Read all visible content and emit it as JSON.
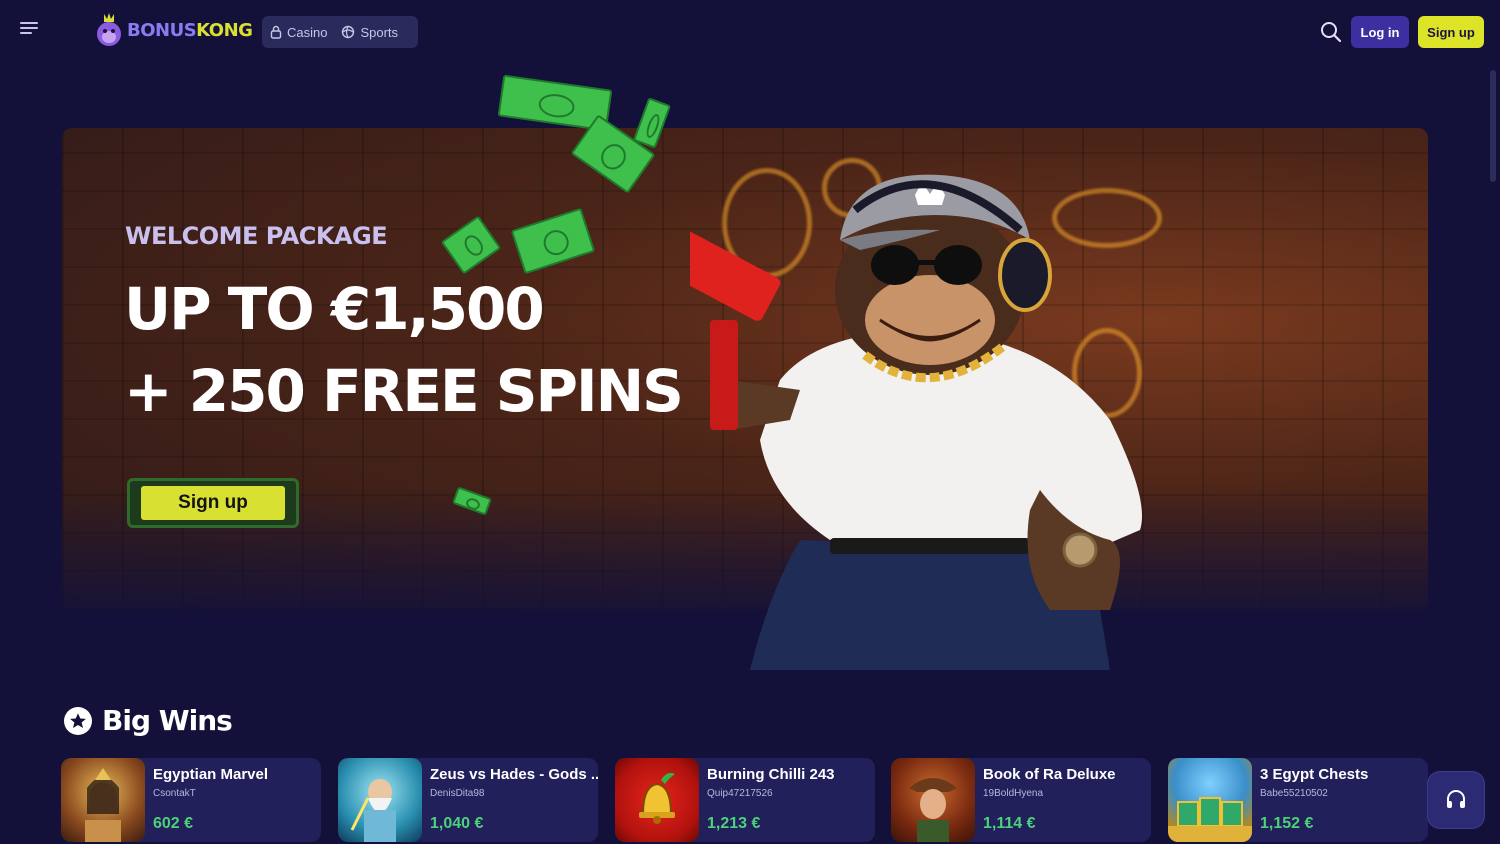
{
  "header": {
    "logo_part1": "BONUS",
    "logo_part2": "KONG",
    "nav": [
      {
        "label": "Casino",
        "icon": "lock-icon"
      },
      {
        "label": "Sports",
        "icon": "ball-icon"
      }
    ],
    "login_label": "Log in",
    "signup_label": "Sign up"
  },
  "hero": {
    "kicker": "WELCOME PACKAGE",
    "line1": "UP TO €1,500",
    "line2": "+ 250 FREE SPINS",
    "cta_label": "Sign up"
  },
  "big_wins": {
    "title": "Big Wins",
    "items": [
      {
        "game": "Egyptian Marvel",
        "user": "CsontakT",
        "amount": "602 €"
      },
      {
        "game": "Zeus vs Hades - Gods ...",
        "user": "DenisDita98",
        "amount": "1,040 €"
      },
      {
        "game": "Burning Chilli 243",
        "user": "Quip47217526",
        "amount": "1,213 €"
      },
      {
        "game": "Book of Ra Deluxe",
        "user": "19BoldHyena",
        "amount": "1,114 €"
      },
      {
        "game": "3 Egypt Chests",
        "user": "Babe55210502",
        "amount": "1,152 €"
      }
    ]
  },
  "colors": {
    "background": "#13113a",
    "accent_yellow": "#dde327",
    "accent_purple": "#3c2fa0",
    "win_green": "#4cd27a"
  }
}
